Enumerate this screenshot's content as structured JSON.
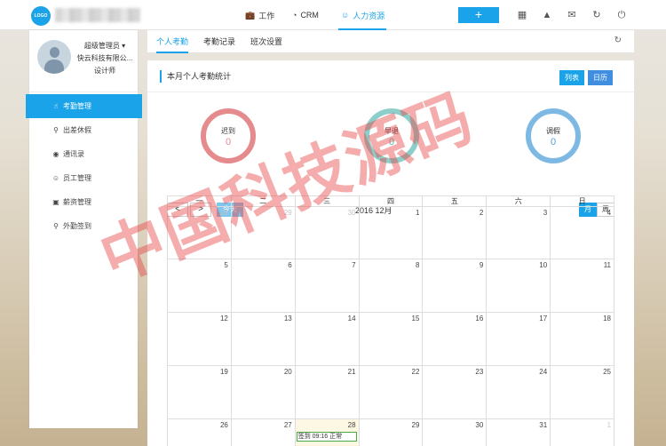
{
  "header": {
    "logo_text": "LOGO",
    "nav": [
      {
        "label": "工作",
        "icon": "briefcase-icon"
      },
      {
        "label": "CRM",
        "icon": "pie-chart-icon"
      },
      {
        "label": "人力资源",
        "icon": "users-icon",
        "active": true
      }
    ],
    "add_label": "+",
    "icons": [
      "grid-icon",
      "shirt-icon",
      "mail-icon",
      "refresh-icon",
      "power-icon"
    ]
  },
  "profile": {
    "role": "超级管理员 ▾",
    "company": "快云科技有限公...",
    "title": "设计师"
  },
  "sidebar": {
    "items": [
      {
        "label": "考勤管理",
        "icon": "hand-pointer-icon",
        "active": true
      },
      {
        "label": "出差休假",
        "icon": "map-pin-icon"
      },
      {
        "label": "通讯录",
        "icon": "contact-icon"
      },
      {
        "label": "员工管理",
        "icon": "users-icon"
      },
      {
        "label": "薪资管理",
        "icon": "wallet-icon"
      },
      {
        "label": "外勤签到",
        "icon": "location-icon"
      }
    ]
  },
  "tabs": [
    {
      "label": "个人考勤",
      "active": true
    },
    {
      "label": "考勤记录"
    },
    {
      "label": "班次设置"
    }
  ],
  "card": {
    "title": "本月个人考勤统计",
    "view_list": "列表",
    "view_calendar": "日历"
  },
  "stats": [
    {
      "label": "迟到",
      "value": "0",
      "color": "#e58a8d"
    },
    {
      "label": "早退",
      "value": "0",
      "color": "#8ccfca"
    },
    {
      "label": "调假",
      "value": "0",
      "color": "#7db9e3"
    }
  ],
  "calendar": {
    "prev": "<",
    "next": ">",
    "today": "今天",
    "month": "2016 12月",
    "mode_month": "月",
    "mode_week": "周",
    "weekdays": [
      "一",
      "二",
      "三",
      "四",
      "五",
      "六",
      "日"
    ],
    "weeks": [
      [
        {
          "d": "28",
          "o": true
        },
        {
          "d": "29",
          "o": true
        },
        {
          "d": "30",
          "o": true
        },
        {
          "d": "1"
        },
        {
          "d": "2"
        },
        {
          "d": "3"
        },
        {
          "d": "4"
        }
      ],
      [
        {
          "d": "5"
        },
        {
          "d": "6"
        },
        {
          "d": "7"
        },
        {
          "d": "8"
        },
        {
          "d": "9"
        },
        {
          "d": "10"
        },
        {
          "d": "11"
        }
      ],
      [
        {
          "d": "12"
        },
        {
          "d": "13"
        },
        {
          "d": "14"
        },
        {
          "d": "15"
        },
        {
          "d": "16"
        },
        {
          "d": "17"
        },
        {
          "d": "18"
        }
      ],
      [
        {
          "d": "19"
        },
        {
          "d": "20"
        },
        {
          "d": "21"
        },
        {
          "d": "22"
        },
        {
          "d": "23"
        },
        {
          "d": "24"
        },
        {
          "d": "25"
        }
      ],
      [
        {
          "d": "26"
        },
        {
          "d": "27"
        },
        {
          "d": "28",
          "today": true,
          "event": "签到 09:16 正常"
        },
        {
          "d": "29"
        },
        {
          "d": "30"
        },
        {
          "d": "31"
        },
        {
          "d": "1",
          "o": true
        }
      ]
    ]
  },
  "watermark": "中国科技源码"
}
